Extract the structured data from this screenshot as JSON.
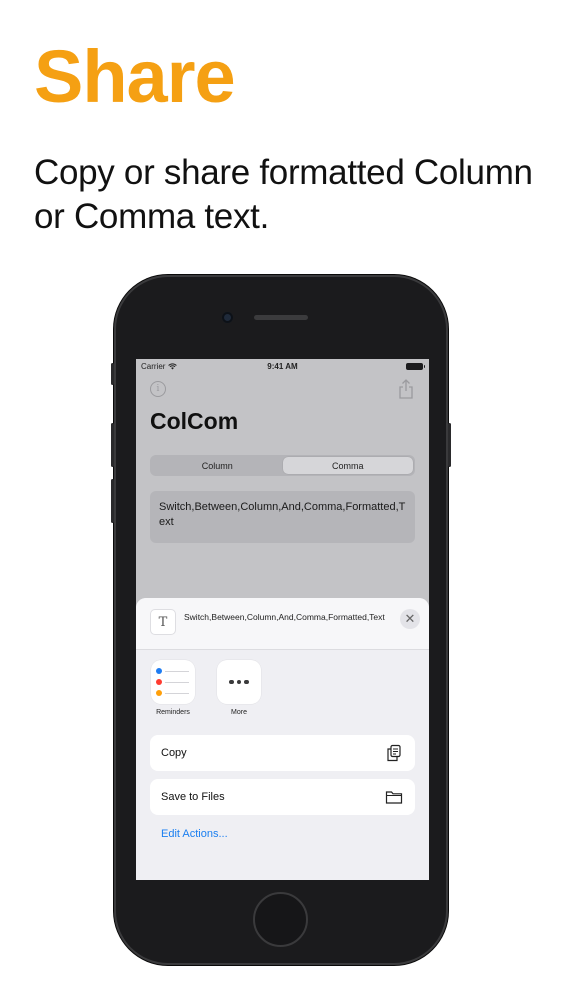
{
  "promo": {
    "headline": "Share",
    "subline": "Copy or share formatted Column or Comma text."
  },
  "statusbar": {
    "carrier": "Carrier",
    "time": "9:41 AM"
  },
  "app": {
    "title": "ColCom",
    "segments": [
      "Column",
      "Comma"
    ],
    "selected_segment": "Comma",
    "output_text": "Switch,Between,Column,And,Comma,Formatted,Text"
  },
  "share_sheet": {
    "preview_icon": "T",
    "preview_text": "Switch,Between,Column,And,Comma,Formatted,Text",
    "apps": [
      {
        "label": "Reminders",
        "icon": "reminders-icon"
      },
      {
        "label": "More",
        "icon": "more-icon"
      }
    ],
    "actions": [
      {
        "label": "Copy",
        "icon": "copy-icon"
      },
      {
        "label": "Save to Files",
        "icon": "folder-icon"
      }
    ],
    "edit_actions_label": "Edit Actions..."
  },
  "colors": {
    "headline": "#f5a013",
    "link": "#1b7ff0"
  }
}
